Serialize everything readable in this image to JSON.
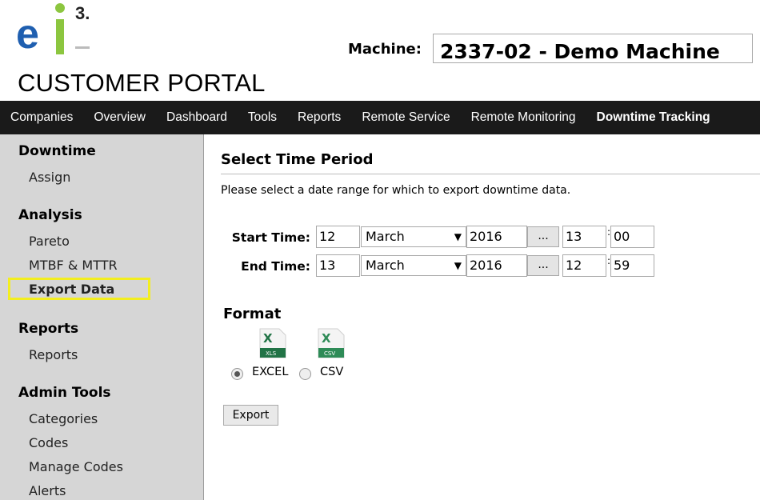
{
  "logo": {
    "text_e": "e",
    "text_i": "i",
    "superscript": "3."
  },
  "header": {
    "portal_title": "CUSTOMER PORTAL",
    "machine_label": "Machine:",
    "machine_value": "2337-02 - Demo Machine"
  },
  "nav": {
    "items": [
      {
        "label": "Companies"
      },
      {
        "label": "Overview"
      },
      {
        "label": "Dashboard"
      },
      {
        "label": "Tools"
      },
      {
        "label": "Reports"
      },
      {
        "label": "Remote Service"
      },
      {
        "label": "Remote Monitoring"
      },
      {
        "label": "Downtime Tracking"
      }
    ]
  },
  "sidebar": {
    "downtime_heading": "Downtime",
    "assign": "Assign",
    "analysis_heading": "Analysis",
    "pareto": "Pareto",
    "mtbf": "MTBF & MTTR",
    "export_data": "Export Data",
    "reports_heading": "Reports",
    "reports": "Reports",
    "admin_heading": "Admin Tools",
    "categories": "Categories",
    "codes": "Codes",
    "manage_codes": "Manage Codes",
    "alerts": "Alerts"
  },
  "main": {
    "title": "Select Time Period",
    "instructions": "Please select a date range for which to export downtime data.",
    "start": {
      "label": "Start Time:",
      "day": "12",
      "month": "March",
      "year": "2016",
      "picker": "...",
      "hour": "13",
      "minute": "00"
    },
    "end": {
      "label": "End Time:",
      "day": "13",
      "month": "March",
      "year": "2016",
      "picker": "...",
      "hour": "12",
      "minute": "59"
    },
    "colon": ":",
    "format_title": "Format",
    "formats": [
      {
        "label": "EXCEL",
        "icon_text": "XLS",
        "checked": true
      },
      {
        "label": "CSV",
        "icon_text": "CSV",
        "checked": false
      }
    ],
    "export_button": "Export"
  },
  "colors": {
    "navbar": "#1a1a1a",
    "sidebar": "#d6d6d6",
    "highlight": "#f3ee1f",
    "excel_green": "#217346",
    "logo_blue": "#1f5fb0",
    "logo_green": "#8cc63f"
  }
}
